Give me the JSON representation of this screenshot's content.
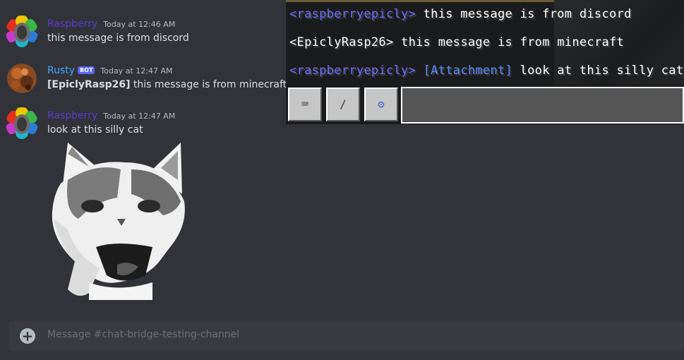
{
  "messages": [
    {
      "author": "Raspberry",
      "timestamp": "Today at 12:46 AM",
      "text": "this message is from discord"
    },
    {
      "author": "Rusty",
      "badge": "BOT",
      "timestamp": "Today at 12:47 AM",
      "bold_prefix": "[EpiclyRasp26]",
      "text": " this message is from minecraft"
    },
    {
      "author": "Raspberry",
      "timestamp": "Today at 12:47 AM",
      "text": "look at this silly cat"
    }
  ],
  "composer": {
    "placeholder": "Message #chat-bridge-testing-channel",
    "plus_icon": "plus-circle-icon"
  },
  "minecraft": {
    "lines": [
      {
        "name": "<raspberryepicly>",
        "text": " this message is from discord"
      },
      {
        "name_plain": "<EpiclyRasp26>",
        "text": " this message is from minecraft"
      },
      {
        "name": "<raspberryepicly>",
        "attachment": "[Attachment]",
        "text": " look at this silly cat"
      }
    ],
    "buttons": [
      {
        "icon": "keyboard-icon",
        "glyph": "⌨"
      },
      {
        "icon": "slash-command-icon",
        "glyph": "/"
      },
      {
        "icon": "settings-gear-icon",
        "glyph": "⚙"
      }
    ]
  },
  "colors": {
    "background": "#313338",
    "raspberry_name": "#5a3acb",
    "rusty_name": "#43a6ff",
    "bot_badge": "#5865f2",
    "mc_player_name": "#6d6dff"
  }
}
